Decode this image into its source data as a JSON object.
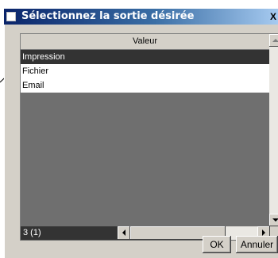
{
  "window": {
    "title": "Sélectionnez la sortie désirée",
    "close_glyph": "X"
  },
  "grid": {
    "column_header": "Valeur",
    "rows": [
      {
        "label": "Impression",
        "selected": true
      },
      {
        "label": "Fichier",
        "selected": false
      },
      {
        "label": "Email",
        "selected": false
      }
    ],
    "record_count": "3 (1)"
  },
  "buttons": {
    "ok_label": "OK",
    "cancel_label": "Annuler"
  },
  "icons": {
    "sys_menu": "window-icon",
    "close": "close-icon"
  },
  "colors": {
    "title_start": "#0a246a",
    "selection": "#333333",
    "grid_bg": "#6f6f6f",
    "face": "#d4d0c8"
  }
}
